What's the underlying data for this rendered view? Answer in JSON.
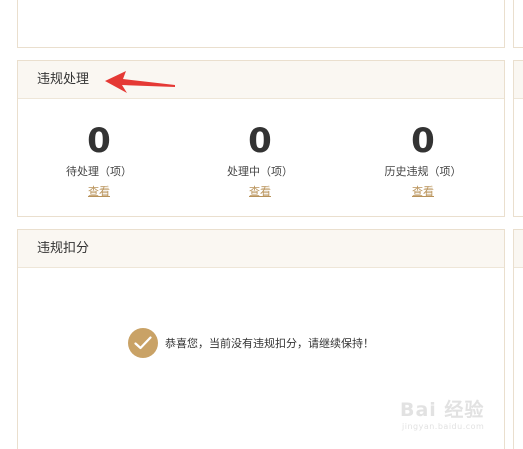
{
  "violation_panel": {
    "title": "违规处理",
    "stats": [
      {
        "value": "0",
        "label": "待处理（项）",
        "link": "查看"
      },
      {
        "value": "0",
        "label": "处理中（项）",
        "link": "查看"
      },
      {
        "value": "0",
        "label": "历史违规（项）",
        "link": "查看"
      }
    ]
  },
  "deduction_panel": {
    "title": "违规扣分",
    "message": "恭喜您，当前没有违规扣分，请继续保持！"
  },
  "annotation": {
    "arrow_color": "#e53935"
  },
  "watermark": {
    "main": "Bai 经验",
    "sub": "jingyan.baidu.com"
  },
  "colors": {
    "accent": "#c9a266",
    "link": "#b9935a",
    "border": "#eadfce",
    "header_bg": "#faf7f2"
  }
}
